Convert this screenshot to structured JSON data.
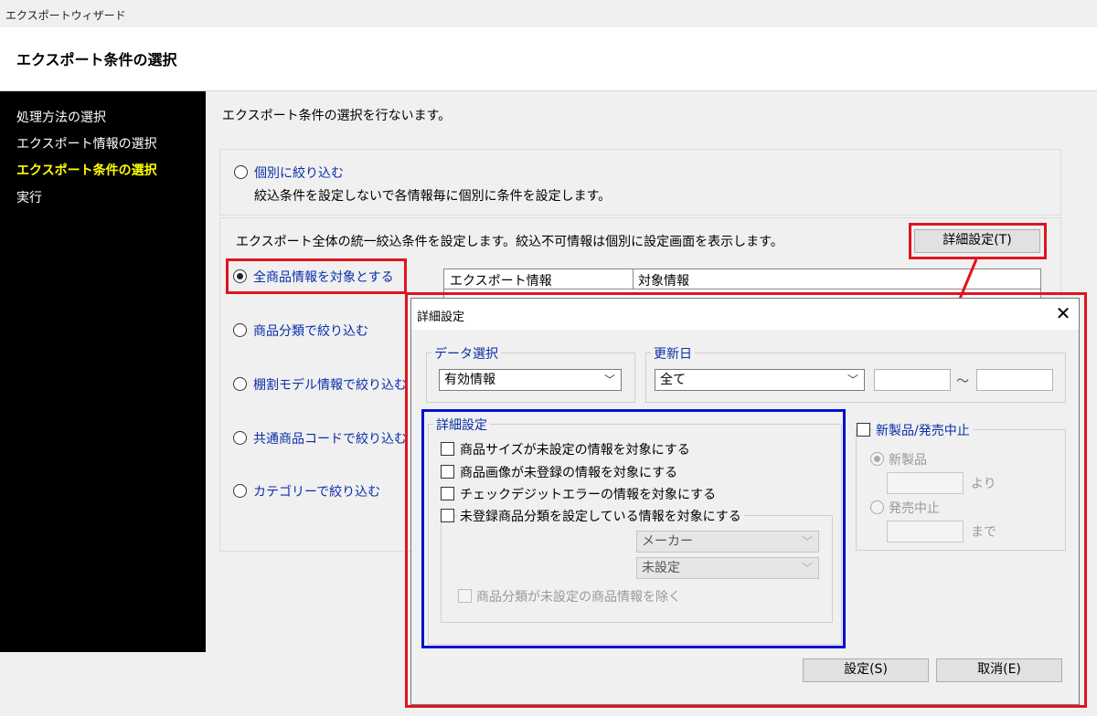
{
  "window": {
    "title": "エクスポートウィザード"
  },
  "header": {
    "title": "エクスポート条件の選択"
  },
  "sidebar": {
    "items": [
      {
        "label": "処理方法の選択",
        "active": false
      },
      {
        "label": "エクスポート情報の選択",
        "active": false
      },
      {
        "label": "エクスポート条件の選択",
        "active": true
      },
      {
        "label": "実行",
        "active": false
      }
    ]
  },
  "main": {
    "description": "エクスポート条件の選択を行ないます。",
    "individual": {
      "label": "個別に絞り込む",
      "desc": "絞込条件を設定しないで各情報毎に個別に条件を設定します。",
      "selected": false
    },
    "unified_desc": "エクスポート全体の統一絞込条件を設定します。絞込不可情報は個別に設定画面を表示します。",
    "detail_button": "詳細設定(T)",
    "options": [
      {
        "label": "全商品情報を対象とする",
        "selected": true
      },
      {
        "label": "商品分類で絞り込む",
        "selected": false
      },
      {
        "label": "棚割モデル情報で絞り込む",
        "selected": false
      },
      {
        "label": "共通商品コードで絞り込む",
        "selected": false
      },
      {
        "label": "カテゴリーで絞り込む",
        "selected": false
      }
    ],
    "table": {
      "headers": [
        "エクスポート情報",
        "対象情報"
      ]
    }
  },
  "dialog": {
    "title": "詳細設定",
    "close": "✕",
    "data_select": {
      "label": "データ選択",
      "value": "有効情報"
    },
    "update_date": {
      "label": "更新日",
      "value": "全て",
      "tilde": "～"
    },
    "detail": {
      "label": "詳細設定",
      "checks": [
        "商品サイズが未設定の情報を対象にする",
        "商品画像が未登録の情報を対象にする",
        "チェックデジットエラーの情報を対象にする",
        "未登録商品分類を設定している情報を対象にする"
      ],
      "maker": "メーカー",
      "unset": "未設定",
      "exclude": "商品分類が未設定の商品情報を除く"
    },
    "new_product": {
      "label": "新製品/発売中止",
      "new_label": "新製品",
      "from": "より",
      "discontinued_label": "発売中止",
      "until": "まで"
    },
    "ok": "設定(S)",
    "cancel": "取消(E)"
  },
  "colors": {
    "annotation_red": "#e0141e",
    "annotation_blue": "#0010d0",
    "link_blue": "#0a2ea8",
    "active_yellow": "#ffff00"
  }
}
